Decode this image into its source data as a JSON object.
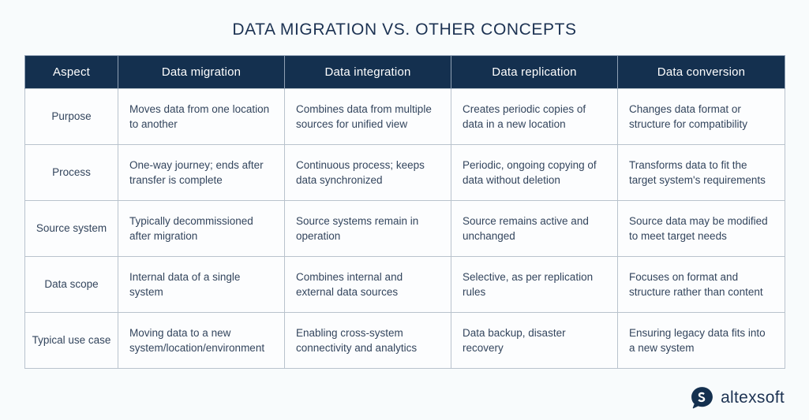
{
  "title": "DATA MIGRATION VS. OTHER CONCEPTS",
  "table": {
    "headers": [
      "Aspect",
      "Data migration",
      "Data integration",
      "Data replication",
      "Data conversion"
    ],
    "rows": [
      {
        "aspect": "Purpose",
        "cells": [
          "Moves data from one location to another",
          "Combines data from multiple sources for unified view",
          "Creates periodic copies of data in a new location",
          "Changes data format or structure for compatibility"
        ]
      },
      {
        "aspect": "Process",
        "cells": [
          "One-way journey; ends after transfer is complete",
          "Continuous process; keeps data synchronized",
          "Periodic, ongoing copying of data without deletion",
          "Transforms data to fit the target system's requirements"
        ]
      },
      {
        "aspect": "Source system",
        "cells": [
          "Typically decommissioned after migration",
          "Source systems remain in operation",
          "Source remains active and unchanged",
          "Source data may be modified to meet target needs"
        ]
      },
      {
        "aspect": "Data scope",
        "cells": [
          "Internal data of a single system",
          "Combines internal and external data sources",
          "Selective, as per replication rules",
          "Focuses on format and structure rather than content"
        ]
      },
      {
        "aspect": "Typical use case",
        "cells": [
          "Moving data to a new system/location/environment",
          "Enabling cross-system connectivity and analytics",
          "Data backup, disaster recovery",
          "Ensuring legacy data fits into a new system"
        ]
      }
    ]
  },
  "logo": {
    "icon": "altexsoft-bubble-icon",
    "text": "altexsoft"
  },
  "colors": {
    "header_bg": "#14304f",
    "page_bg": "#f8fbfc",
    "text": "#33455d",
    "border": "#b9c3cd"
  }
}
